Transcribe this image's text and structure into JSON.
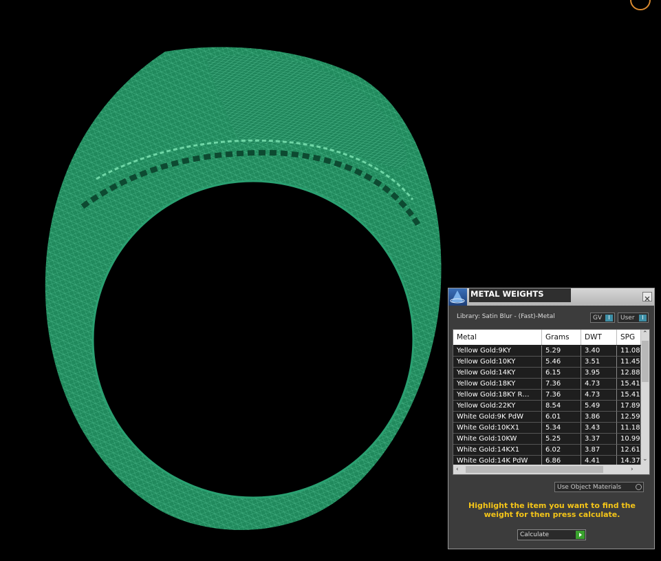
{
  "panel": {
    "title": "METAL WEIGHTS",
    "library": "Library: Satin Blur - (Fast)-Metal",
    "gv_label": "GV",
    "user_label": "User",
    "table": {
      "headers": [
        "Metal",
        "Grams",
        "DWT",
        "SPG"
      ],
      "rows": [
        [
          "Yellow Gold:9KY",
          "5.29",
          "3.40",
          "11.08"
        ],
        [
          "Yellow Gold:10KY",
          "5.46",
          "3.51",
          "11.45"
        ],
        [
          "Yellow Gold:14KY",
          "6.15",
          "3.95",
          "12.88"
        ],
        [
          "Yellow Gold:18KY",
          "7.36",
          "4.73",
          "15.41"
        ],
        [
          "Yellow Gold:18KY R…",
          "7.36",
          "4.73",
          "15.41"
        ],
        [
          "Yellow Gold:22KY",
          "8.54",
          "5.49",
          "17.89"
        ],
        [
          "White Gold:9K PdW",
          "6.01",
          "3.86",
          "12.59"
        ],
        [
          "White Gold:10KX1",
          "5.34",
          "3.43",
          "11.18"
        ],
        [
          "White Gold:10KW",
          "5.25",
          "3.37",
          "10.99"
        ],
        [
          "White Gold:14KX1",
          "6.02",
          "3.87",
          "12.61"
        ],
        [
          "White Gold:14K PdW",
          "6.86",
          "4.41",
          "14.37"
        ]
      ]
    },
    "use_object_materials": "Use Object Materials",
    "hint": "Highlight the item you want to find the weight for then press calculate.",
    "calculate_label": "Calculate"
  },
  "colors": {
    "mesh": "#2f9a6c",
    "background": "#000000",
    "hint": "#f5c518",
    "calculate_go": "#3aa12e"
  }
}
